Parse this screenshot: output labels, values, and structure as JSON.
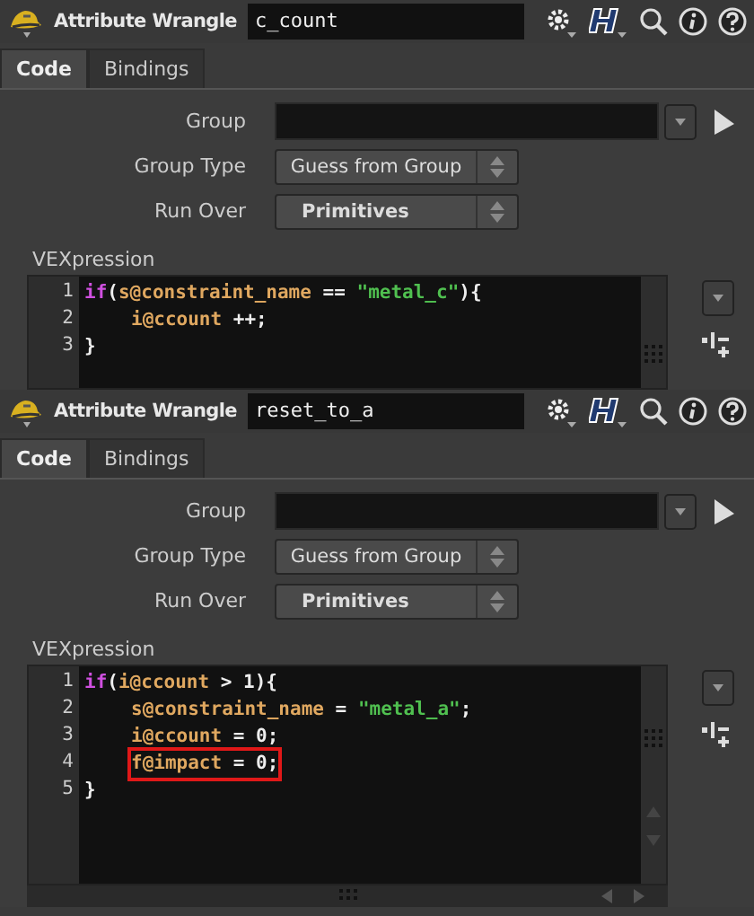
{
  "panels": [
    {
      "node_type": "Attribute Wrangle",
      "node_name": "c_count",
      "tabs": [
        {
          "label": "Code",
          "selected": true
        },
        {
          "label": "Bindings",
          "selected": false
        }
      ],
      "parameters": [
        {
          "kind": "field",
          "label": "Group"
        },
        {
          "kind": "menu",
          "label": "Group Type",
          "value": "Guess from Group",
          "bold": false
        },
        {
          "kind": "menu",
          "label": "Run Over",
          "value": "Primitives",
          "bold": true
        }
      ],
      "editor_label": "VEXpression",
      "scrollbars": false,
      "lines": [
        {
          "number": "1",
          "highlighted": false,
          "tokens": [
            {
              "kind": "keyword",
              "text": "if"
            },
            {
              "kind": "plain",
              "text": "("
            },
            {
              "kind": "attr",
              "text": "s@constraint_name"
            },
            {
              "kind": "plain",
              "text": " == "
            },
            {
              "kind": "string",
              "text": "\"metal_c\""
            },
            {
              "kind": "plain",
              "text": "){"
            }
          ]
        },
        {
          "number": "2",
          "highlighted": false,
          "indent": true,
          "tokens": [
            {
              "kind": "attr",
              "text": "i@ccount"
            },
            {
              "kind": "plain",
              "text": " ++;"
            }
          ]
        },
        {
          "number": "3",
          "highlighted": false,
          "tokens": [
            {
              "kind": "plain",
              "text": "}"
            }
          ]
        }
      ]
    },
    {
      "node_type": "Attribute Wrangle",
      "node_name": "reset_to_a",
      "tabs": [
        {
          "label": "Code",
          "selected": true
        },
        {
          "label": "Bindings",
          "selected": false
        }
      ],
      "parameters": [
        {
          "kind": "field",
          "label": "Group"
        },
        {
          "kind": "menu",
          "label": "Group Type",
          "value": "Guess from Group",
          "bold": false
        },
        {
          "kind": "menu",
          "label": "Run Over",
          "value": "Primitives",
          "bold": true
        }
      ],
      "editor_label": "VEXpression",
      "scrollbars": true,
      "lines": [
        {
          "number": "1",
          "highlighted": false,
          "tokens": [
            {
              "kind": "keyword",
              "text": "if"
            },
            {
              "kind": "plain",
              "text": "("
            },
            {
              "kind": "attr",
              "text": "i@ccount"
            },
            {
              "kind": "plain",
              "text": " > 1){"
            }
          ]
        },
        {
          "number": "2",
          "highlighted": false,
          "indent": true,
          "tokens": [
            {
              "kind": "attr",
              "text": "s@constraint_name"
            },
            {
              "kind": "plain",
              "text": " = "
            },
            {
              "kind": "string",
              "text": "\"metal_a\""
            },
            {
              "kind": "plain",
              "text": ";"
            }
          ]
        },
        {
          "number": "3",
          "highlighted": false,
          "indent": true,
          "tokens": [
            {
              "kind": "attr",
              "text": "i@ccount"
            },
            {
              "kind": "plain",
              "text": " = 0;"
            }
          ]
        },
        {
          "number": "4",
          "highlighted": true,
          "indent": true,
          "tokens": [
            {
              "kind": "attr",
              "text": "f@impact"
            },
            {
              "kind": "plain",
              "text": " = 0;"
            }
          ]
        },
        {
          "number": "5",
          "highlighted": false,
          "tokens": [
            {
              "kind": "plain",
              "text": "}"
            }
          ]
        }
      ]
    }
  ]
}
